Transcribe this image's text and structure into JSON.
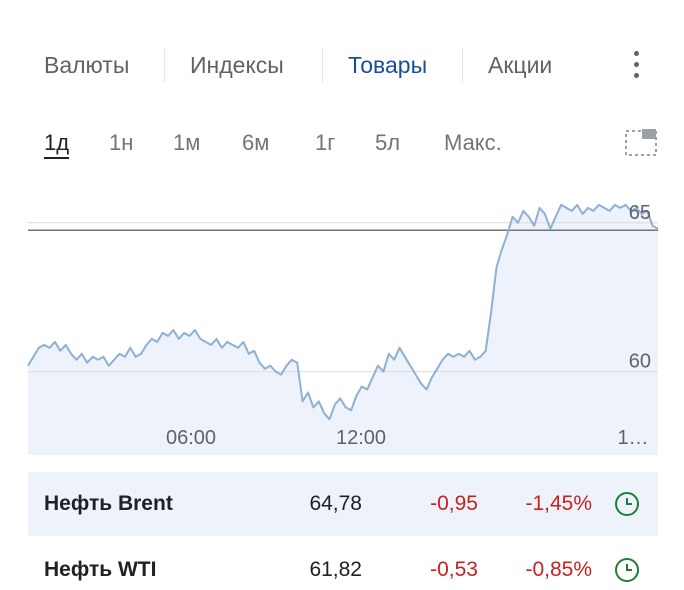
{
  "tabs": [
    {
      "label": "Валюты",
      "active": false
    },
    {
      "label": "Индексы",
      "active": false
    },
    {
      "label": "Товары",
      "active": true
    },
    {
      "label": "Акции",
      "active": false
    }
  ],
  "more_icon": "more-vert-icon",
  "ranges": [
    {
      "label": "1д",
      "active": true
    },
    {
      "label": "1н",
      "active": false
    },
    {
      "label": "1м",
      "active": false
    },
    {
      "label": "6м",
      "active": false
    },
    {
      "label": "1г",
      "active": false
    },
    {
      "label": "5л",
      "active": false
    },
    {
      "label": "Макс.",
      "active": false
    }
  ],
  "expand_icon": "fullscreen-icon",
  "colors": {
    "line": "#8fb0d6",
    "fill": "#eef2fb",
    "prev_close": "#757575",
    "grid": "#dcdcdc",
    "negative": "#c5221f",
    "clock": "#1e7e34",
    "active_tab": "#1a4e9a"
  },
  "chart_data": {
    "type": "area",
    "x_tick_labels": [
      "06:00",
      "12:00",
      "1…"
    ],
    "y_tick_labels": [
      "60",
      "65"
    ],
    "ylim": [
      57.2,
      65.9
    ],
    "previous_close": 64.75,
    "grid": true,
    "series": [
      {
        "values": [
          60.2,
          60.5,
          60.8,
          60.9,
          60.8,
          61.0,
          60.7,
          60.9,
          60.6,
          60.4,
          60.6,
          60.3,
          60.5,
          60.4,
          60.5,
          60.2,
          60.4,
          60.6,
          60.5,
          60.8,
          60.5,
          60.6,
          60.9,
          61.1,
          61.0,
          61.3,
          61.2,
          61.4,
          61.1,
          61.3,
          61.2,
          61.4,
          61.1,
          61.0,
          60.9,
          61.1,
          60.8,
          61.0,
          60.9,
          60.8,
          61.0,
          60.6,
          60.7,
          60.3,
          60.1,
          60.2,
          60.0,
          59.9,
          60.2,
          60.4,
          60.3,
          59.0,
          59.3,
          58.8,
          59.0,
          58.6,
          58.4,
          58.9,
          59.1,
          58.8,
          58.7,
          59.2,
          59.5,
          59.4,
          59.8,
          60.2,
          60.0,
          60.6,
          60.4,
          60.8,
          60.5,
          60.2,
          59.9,
          59.6,
          59.4,
          59.8,
          60.1,
          60.4,
          60.6,
          60.5,
          60.6,
          60.5,
          60.7,
          60.4,
          60.5,
          60.7,
          62.0,
          63.5,
          64.1,
          64.6,
          65.2,
          65.0,
          65.4,
          65.2,
          64.9,
          65.5,
          65.3,
          64.8,
          65.2,
          65.6,
          65.5,
          65.4,
          65.6,
          65.3,
          65.5,
          65.4,
          65.6,
          65.5,
          65.4,
          65.6,
          65.5,
          65.6,
          65.4,
          65.5,
          65.3,
          65.4,
          64.9,
          64.8
        ]
      }
    ]
  },
  "quotes": [
    {
      "name": "Нефть Brent",
      "price": "64,78",
      "change": "-0,95",
      "percent": "-1,45%",
      "icon": "clock-icon",
      "highlighted": true
    },
    {
      "name": "Нефть WTI",
      "price": "61,82",
      "change": "-0,53",
      "percent": "-0,85%",
      "icon": "clock-icon",
      "highlighted": false
    }
  ]
}
